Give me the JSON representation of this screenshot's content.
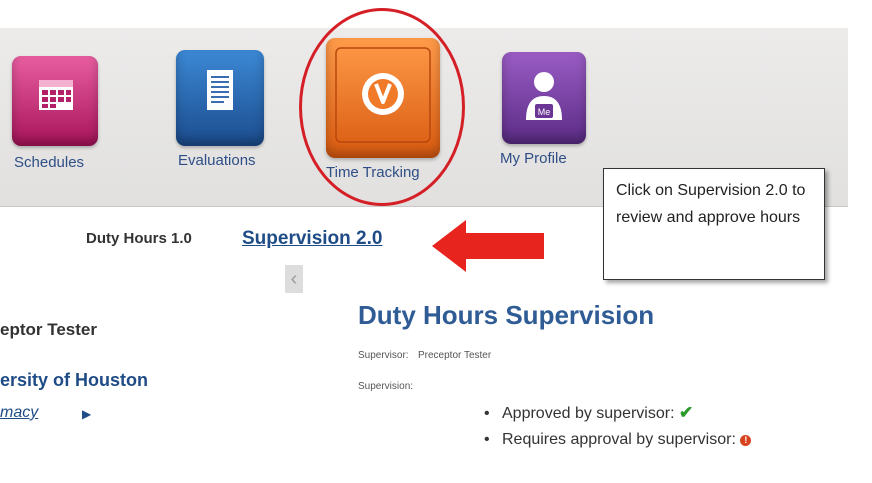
{
  "nav": {
    "schedules_label": "Schedules",
    "evaluations_label": "Evaluations",
    "time_tracking_label": "Time Tracking",
    "my_profile_label": "My Profile",
    "profile_badge": "Me"
  },
  "callout": {
    "text": "Click on Supervision 2.0 to review and approve hours"
  },
  "tabs": {
    "duty_hours_label": "Duty Hours 1.0",
    "supervision_label": "Supervision 2.0"
  },
  "sidebar": {
    "person": "eptor Tester",
    "organization": "ersity of Houston",
    "department": "macy"
  },
  "main": {
    "heading": "Duty Hours Supervision",
    "supervisor_label": "Supervisor:",
    "supervisor_value": "Preceptor Tester",
    "supervision_label": "Supervision:",
    "legend": {
      "approved": "Approved by supervisor:",
      "requires": "Requires approval by supervisor:"
    }
  },
  "colors": {
    "accent_blue": "#1f4c86",
    "highlight_red": "#d51f26",
    "time_tile_orange": "#f07a28"
  }
}
